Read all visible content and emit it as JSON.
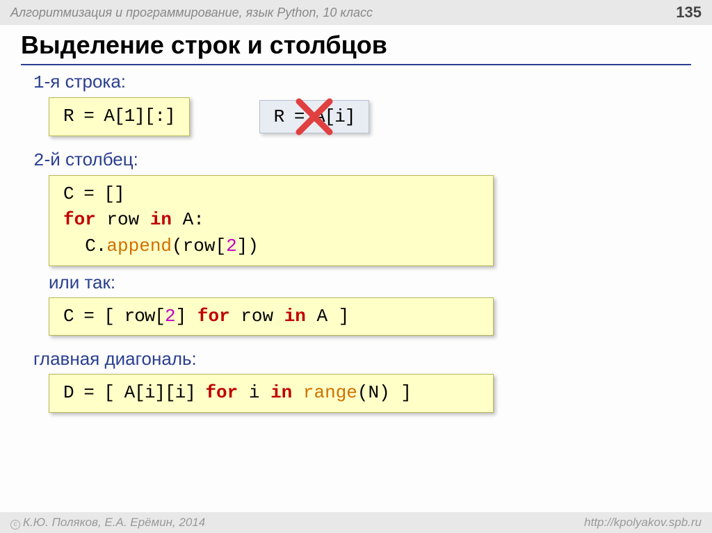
{
  "header": {
    "subject": "Алгоритмизация и программирование, язык Python, 10 класс",
    "page": "135"
  },
  "title": "Выделение строк и столбцов",
  "sec1": {
    "label_num": "1",
    "label_rest": "-я строка:"
  },
  "box1": "R = A[1][:]",
  "box1b": "R = A[i]",
  "sec2": {
    "label_num": "2",
    "label_rest": "-й столбец:"
  },
  "box2": {
    "l1a": "C = []",
    "l2_for": "for",
    "l2_mid": " row ",
    "l2_in": "in",
    "l2_end": " A:",
    "l3_pre": "  C.",
    "l3_fn": "append",
    "l3_open": "(row[",
    "l3_idx": "2",
    "l3_close": "])"
  },
  "or": "или так:",
  "box3": {
    "pre": "C = [ row[",
    "idx": "2",
    "mid": "] ",
    "for": "for",
    "row": " row ",
    "in": "in",
    "end": " A ]"
  },
  "sec3": "главная диагональ:",
  "box4": {
    "pre": "D = [ A[i][i] ",
    "for": "for",
    "mid": " i ",
    "in": "in",
    "sp": " ",
    "fn": "range",
    "args": "(N) ]"
  },
  "footer": {
    "left": "К.Ю. Поляков, Е.А. Ерёмин, 2014",
    "right": "http://kpolyakov.spb.ru"
  }
}
